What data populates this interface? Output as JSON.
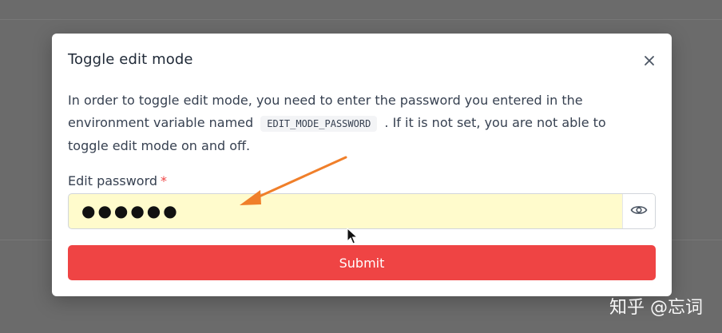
{
  "modal": {
    "title": "Toggle edit mode",
    "description_part1": "In order to toggle edit mode, you need to enter the password you entered in the environment variable named",
    "env_var": "EDIT_MODE_PASSWORD",
    "description_part2": ". If it is not set, you are not able to toggle edit mode on and off.",
    "field_label": "Edit password",
    "required_mark": "*",
    "password_mask": "●●●●●●",
    "submit_label": "Submit"
  },
  "icons": {
    "close": "close-icon",
    "eye": "eye-icon",
    "annotation": "arrow-annotation",
    "pointer": "mouse-pointer"
  },
  "colors": {
    "overlay": "#6b6b6b",
    "submit": "#ef4444",
    "field_autofill": "#fffbcc",
    "annotation_arrow": "#f07f2a"
  },
  "watermark": "知乎 @忘词"
}
